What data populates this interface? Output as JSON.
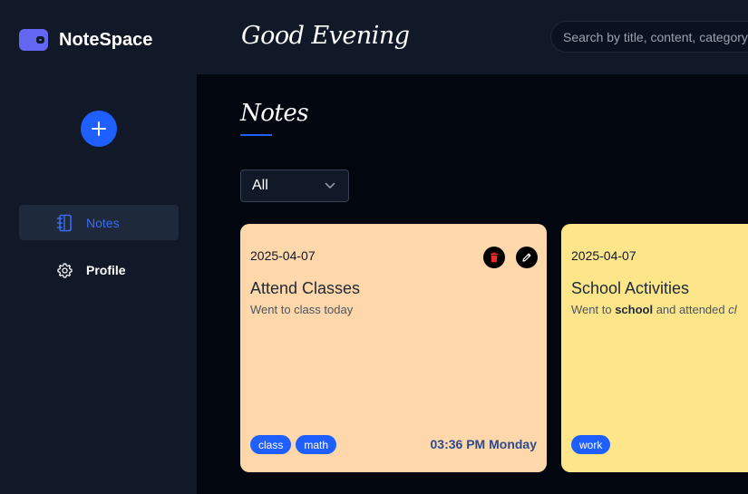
{
  "brand": {
    "name": "NoteSpace",
    "logo_icon": "wallet-icon",
    "logo_color": "#6366f1"
  },
  "sidebar": {
    "add_icon": "plus-icon",
    "items": [
      {
        "label": "Notes",
        "icon": "notebook-icon",
        "active": true
      },
      {
        "label": "Profile",
        "icon": "gear-icon",
        "active": false
      }
    ]
  },
  "header": {
    "greeting": "Good Evening",
    "search_placeholder": "Search by title, content, category"
  },
  "main": {
    "title": "Notes",
    "filter": {
      "selected": "All"
    }
  },
  "notes": [
    {
      "date": "2025-04-07",
      "title": "Attend Classes",
      "description": "Went to class today",
      "tags": [
        "class",
        "math"
      ],
      "time": "03:36 PM Monday",
      "color": "#fed7aa"
    },
    {
      "date": "2025-04-07",
      "title": "School Activities",
      "description_parts": [
        "Went to ",
        "school",
        " and attended ",
        "cl"
      ],
      "tags": [
        "work"
      ],
      "color": "#fde68a"
    }
  ],
  "colors": {
    "accent": "#1f5eff",
    "sidebar_bg": "#111827",
    "main_bg": "#02060f"
  }
}
